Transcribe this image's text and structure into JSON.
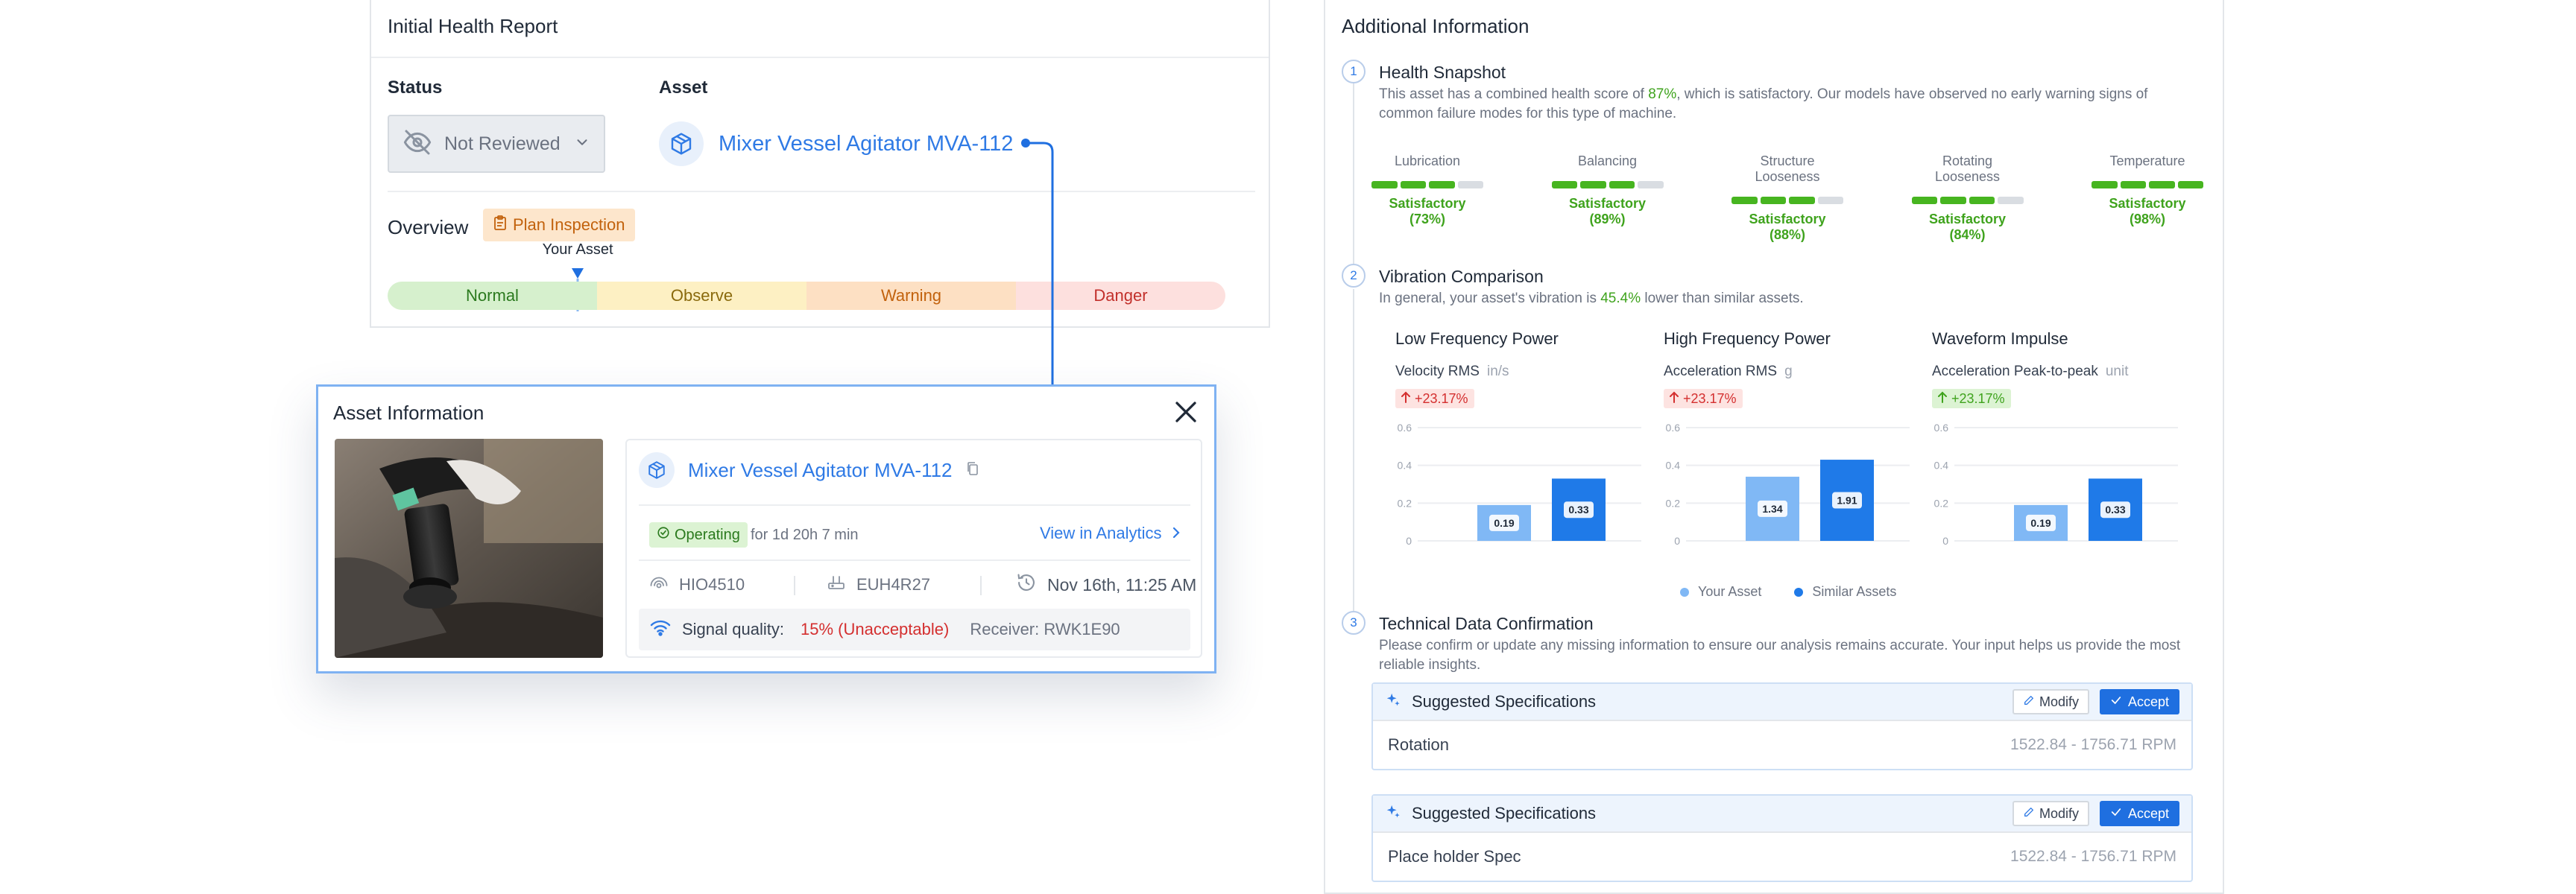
{
  "health_report": {
    "title": "Initial Health Report",
    "status_label": "Status",
    "status_value": "Not Reviewed",
    "asset_label": "Asset",
    "asset_name": "Mixer Vessel Agitator MVA-112",
    "overview_label": "Overview",
    "plan_inspection": "Plan Inspection",
    "your_asset_label": "Your Asset",
    "your_asset_position": 0.227,
    "severity": [
      "Normal",
      "Observe",
      "Warning",
      "Danger"
    ]
  },
  "asset_info": {
    "title": "Asset Information",
    "asset_name": "Mixer Vessel Agitator MVA-112",
    "status_badge": "Operating",
    "duration": "for 1d 20h 7 min",
    "view_analytics": "View in Analytics",
    "sensor_id": "HIO4510",
    "gateway_id": "EUH4R27",
    "timestamp": "Nov 16th, 11:25 AM",
    "signal_label": "Signal quality:",
    "signal_value": "15% (Unacceptable)",
    "receiver": "Receiver: RWK1E90"
  },
  "additional": {
    "title": "Additional Information",
    "sections": [
      {
        "num": "1",
        "title": "Health Snapshot",
        "desc_pre": "This asset has a combined health score of ",
        "desc_score": "87%",
        "desc_post": ", which is satisfactory. Our models have observed no early warning signs of common failure modes for this type of machine."
      },
      {
        "num": "2",
        "title": "Vibration Comparison",
        "desc_pre": "In general, your asset's vibration is ",
        "desc_pct": "45.4%",
        "desc_post": " lower than similar assets."
      },
      {
        "num": "3",
        "title": "Technical Data Confirmation",
        "desc": "Please confirm or update any missing information to ensure our analysis remains accurate. Your input helps us provide the most reliable insights."
      }
    ],
    "metrics": [
      {
        "name": "Lubrication",
        "status": "Satisfactory (73%)",
        "segments_on": 3
      },
      {
        "name": "Balancing",
        "status": "Satisfactory (89%)",
        "segments_on": 3
      },
      {
        "name": "Structure Looseness",
        "status": "Satisfactory (88%)",
        "segments_on": 3
      },
      {
        "name": "Rotating Looseness",
        "status": "Satisfactory (84%)",
        "segments_on": 3
      },
      {
        "name": "Temperature",
        "status": "Satisfactory (98%)",
        "segments_on": 4
      }
    ],
    "legend": {
      "your_asset": "Your Asset",
      "similar_assets": "Similar Assets"
    },
    "specs": [
      {
        "head": "Suggested Specifications",
        "modify": "Modify",
        "accept": "Accept",
        "name": "Rotation",
        "value": "1522.84 - 1756.71 RPM"
      },
      {
        "head": "Suggested Specifications",
        "modify": "Modify",
        "accept": "Accept",
        "name": "Place holder Spec",
        "value": "1522.84 - 1756.71 RPM"
      }
    ]
  },
  "colors": {
    "accent": "#2f7ae5",
    "your_asset_bar": "#80b8f5",
    "similar_bar": "#1f7ae8",
    "good": "#47b520"
  },
  "chart_data": [
    {
      "type": "bar",
      "title": "Low Frequency Power",
      "ylabel": "Velocity RMS",
      "unit": "in/s",
      "delta": "+23.17%",
      "delta_tone": "red",
      "ylim": [
        0,
        0.6
      ],
      "yticks": [
        "0",
        "0.2",
        "0.4",
        "0.6"
      ],
      "series": [
        {
          "name": "Your Asset",
          "values": [
            0.19
          ]
        },
        {
          "name": "Similar Assets",
          "values": [
            0.33
          ]
        }
      ],
      "labels": [
        "0.19",
        "0.33"
      ]
    },
    {
      "type": "bar",
      "title": "High Frequency Power",
      "ylabel": "Acceleration RMS",
      "unit": "g",
      "delta": "+23.17%",
      "delta_tone": "red",
      "ylim": [
        0,
        0.6
      ],
      "yticks": [
        "0",
        "0.2",
        "0.4",
        "0.6"
      ],
      "series": [
        {
          "name": "Your Asset",
          "values": [
            0.34
          ]
        },
        {
          "name": "Similar Assets",
          "values": [
            0.43
          ]
        }
      ],
      "labels": [
        "1.34",
        "1.91"
      ]
    },
    {
      "type": "bar",
      "title": "Waveform Impulse",
      "ylabel": "Acceleration Peak-to-peak",
      "unit": "unit",
      "delta": "+23.17%",
      "delta_tone": "green",
      "ylim": [
        0,
        0.6
      ],
      "yticks": [
        "0",
        "0.2",
        "0.4",
        "0.6"
      ],
      "series": [
        {
          "name": "Your Asset",
          "values": [
            0.19
          ]
        },
        {
          "name": "Similar Assets",
          "values": [
            0.33
          ]
        }
      ],
      "labels": [
        "0.19",
        "0.33"
      ]
    }
  ]
}
